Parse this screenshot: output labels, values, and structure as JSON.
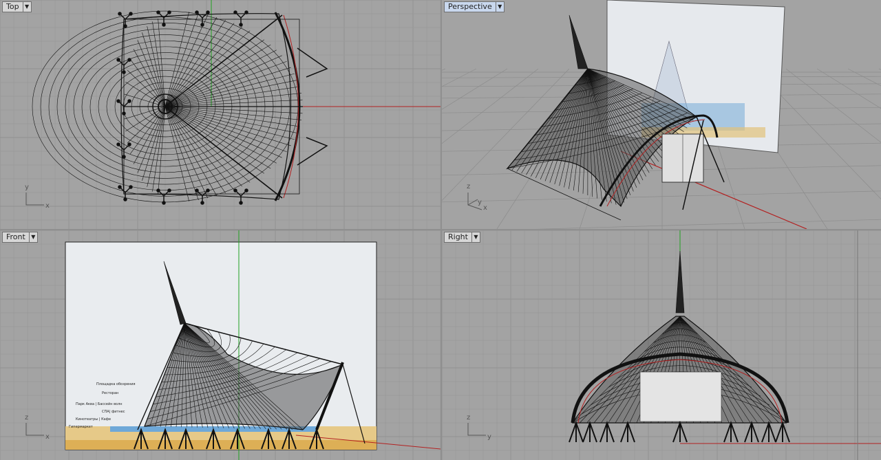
{
  "viewports": {
    "top": {
      "title": "Top",
      "axes": {
        "a": "y",
        "b": "x"
      }
    },
    "perspective": {
      "title": "Perspective",
      "axes": {
        "a": "z",
        "b": "y",
        "c": "x"
      }
    },
    "front": {
      "title": "Front",
      "axes": {
        "a": "z",
        "b": "x"
      },
      "image_labels": [
        "Площадка обозрения",
        "Ресторан",
        "Парк Аква | Бассейн волн",
        "СПА| фитнес",
        "Кинотеатры | Кафе",
        "Гипермаркет"
      ]
    },
    "right": {
      "title": "Right",
      "axes": {
        "a": "z",
        "b": "y"
      }
    }
  },
  "colors": {
    "viewport_bg": "#a3a3a3",
    "grid_minor": "#9a9a9a",
    "grid_major": "#8c8c8c",
    "x_axis": "#b32020",
    "y_axis": "#20a020",
    "mesh": "#111111",
    "tab_active": "#c9d8ee"
  },
  "icons": {
    "viewport_menu": "triangle-down-icon"
  }
}
